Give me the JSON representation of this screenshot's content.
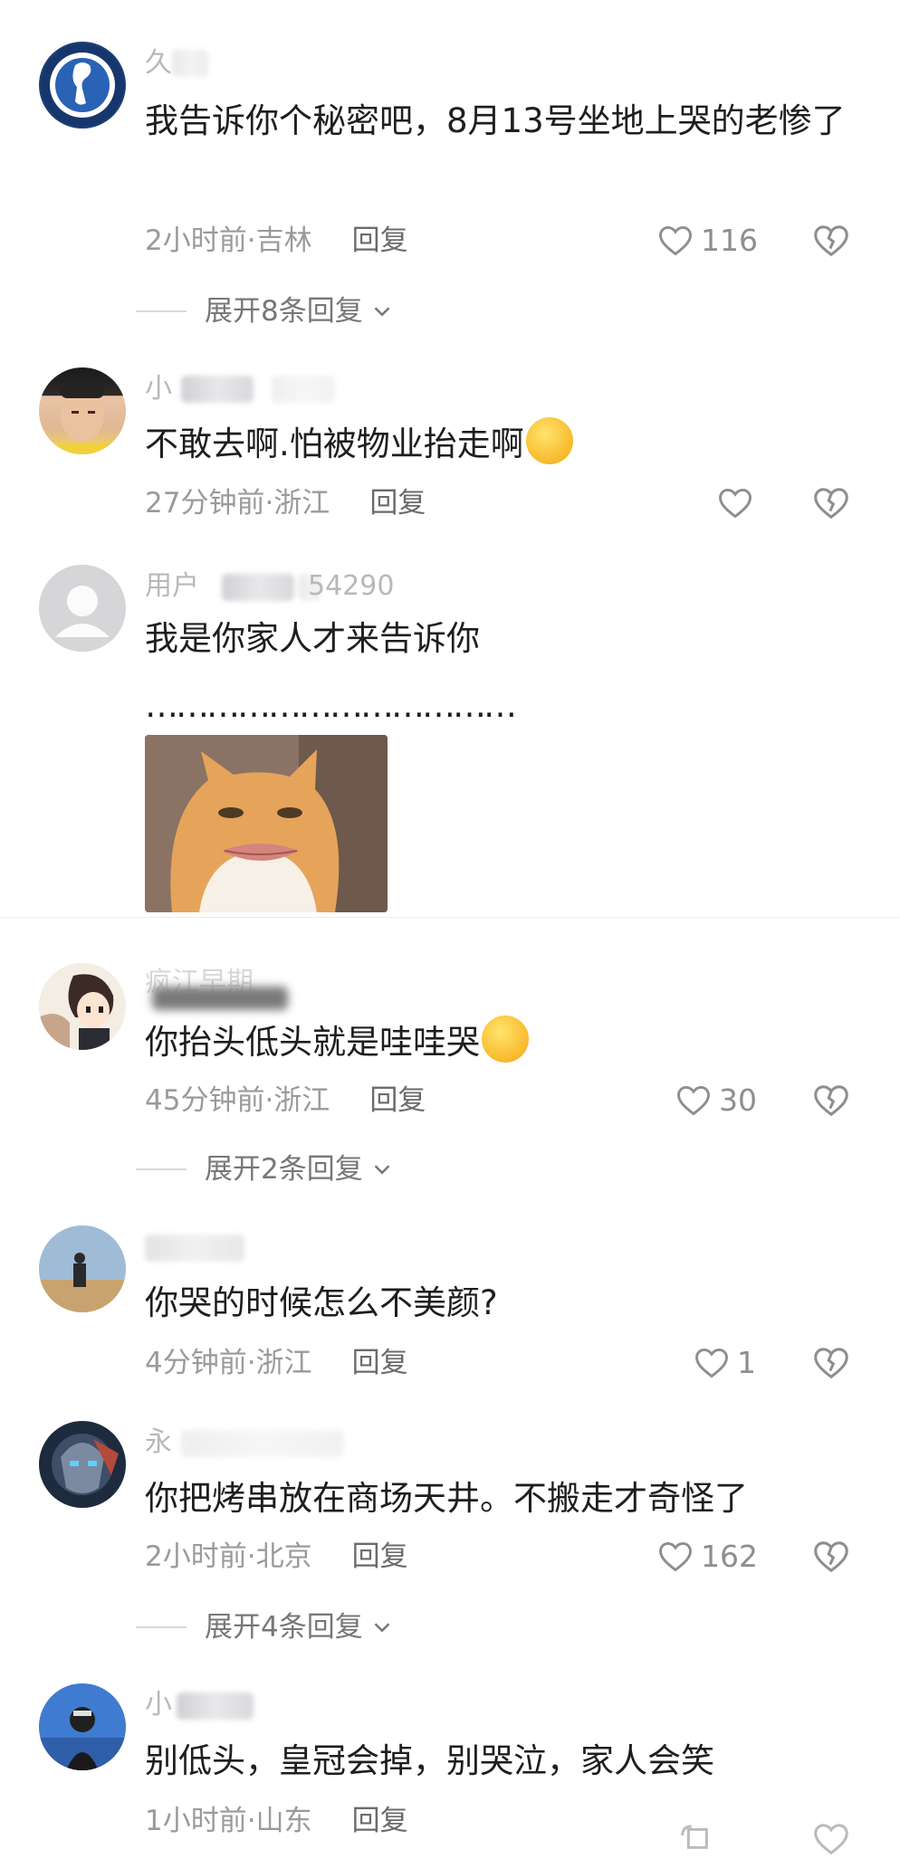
{
  "comments": [
    {
      "username": "久",
      "text": "我告诉你个秘密吧，8月13号坐地上哭的老惨了",
      "time": "2小时前",
      "location": "吉林",
      "reply_label": "回复",
      "likes": "116",
      "expand": "展开8条回复"
    },
    {
      "username": "小",
      "text": "不敢去啊.怕被物业抬走啊",
      "time": "27分钟前",
      "location": "浙江",
      "reply_label": "回复"
    },
    {
      "username": "用户",
      "username_tail": "54290",
      "text": "我是你家人才来告诉你",
      "text2": "………………………………"
    },
    {
      "username": "疯江早期",
      "text": "你抬头低头就是哇哇哭",
      "time": "45分钟前",
      "location": "浙江",
      "reply_label": "回复",
      "likes": "30",
      "expand": "展开2条回复"
    },
    {
      "username": "",
      "text": "你哭的时候怎么不美颜?",
      "time": "4分钟前",
      "location": "浙江",
      "reply_label": "回复",
      "likes": "1"
    },
    {
      "username": "永",
      "text": "你把烤串放在商场天井。不搬走才奇怪了",
      "time": "2小时前",
      "location": "北京",
      "reply_label": "回复",
      "likes": "162",
      "expand": "展开4条回复"
    },
    {
      "username": "小",
      "text": "别低头，皇冠会掉，别哭泣，家人会笑",
      "time": "1小时前",
      "location": "山东",
      "reply_label": "回复"
    }
  ],
  "separator": " · ",
  "icons": {
    "like": "heart-outline-icon",
    "dislike": "broken-heart-icon",
    "expand": "chevron-down-icon"
  },
  "colors": {
    "text": "#1e1e1e",
    "meta": "#9a9a9a",
    "icon": "#8e8e8e"
  }
}
